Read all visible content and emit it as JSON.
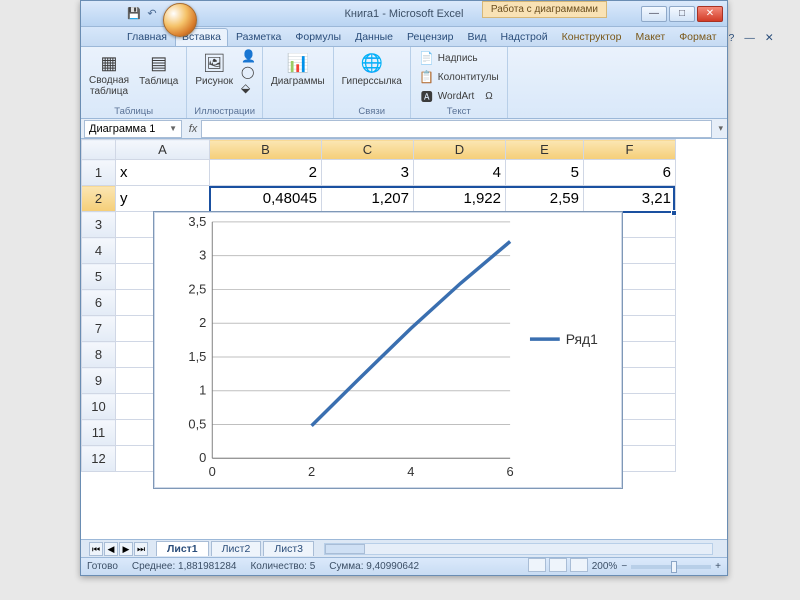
{
  "window": {
    "title": "Книга1 - Microsoft Excel",
    "contextual_tools": "Работа с диаграммами"
  },
  "tabs": {
    "items": [
      "Главная",
      "Вставка",
      "Разметка",
      "Формулы",
      "Данные",
      "Рецензир",
      "Вид",
      "Надстрой"
    ],
    "context_items": [
      "Конструктор",
      "Макет",
      "Формат"
    ],
    "active": "Вставка",
    "help": "?"
  },
  "ribbon": {
    "tables": {
      "pivot": "Сводная\nтаблица",
      "table": "Таблица",
      "label": "Таблицы"
    },
    "illus": {
      "pic": "Рисунок",
      "label": "Иллюстрации"
    },
    "charts": {
      "btn": "Диаграммы",
      "label": ""
    },
    "links": {
      "btn": "Гиперссылка",
      "label": "Связи"
    },
    "text": {
      "a": "Надпись",
      "b": "Колонтитулы",
      "c": "WordArt",
      "label": "Текст"
    }
  },
  "formula_bar": {
    "namebox": "Диаграмма 1",
    "fx": "fx"
  },
  "grid": {
    "cols": [
      "A",
      "B",
      "C",
      "D",
      "E",
      "F"
    ],
    "rows": [
      "1",
      "2",
      "3",
      "4",
      "5",
      "6",
      "7",
      "8",
      "9",
      "10",
      "11",
      "12"
    ],
    "r1": {
      "A": "x",
      "B": "2",
      "C": "3",
      "D": "4",
      "E": "5",
      "F": "6"
    },
    "r2": {
      "A": "y",
      "B": "0,48045",
      "C": "1,207",
      "D": "1,922",
      "E": "2,59",
      "F": "3,21"
    }
  },
  "chart_data": {
    "type": "line",
    "series": [
      {
        "name": "Ряд1",
        "x": [
          2,
          3,
          4,
          5,
          6
        ],
        "values": [
          0.48045,
          1.207,
          1.922,
          2.59,
          3.21
        ]
      }
    ],
    "ylim": [
      0,
      3.5
    ],
    "yticks": [
      "0",
      "0,5",
      "1",
      "1,5",
      "2",
      "2,5",
      "3",
      "3,5"
    ],
    "xlim": [
      0,
      6
    ],
    "xticks": [
      "0",
      "2",
      "4",
      "6"
    ],
    "legend": "Ряд1"
  },
  "sheets": {
    "active": "Лист1",
    "items": [
      "Лист1",
      "Лист2",
      "Лист3"
    ]
  },
  "status": {
    "ready": "Готово",
    "avg": "Среднее: 1,881981284",
    "count": "Количество: 5",
    "sum": "Сумма: 9,40990642",
    "zoom": "200%"
  }
}
